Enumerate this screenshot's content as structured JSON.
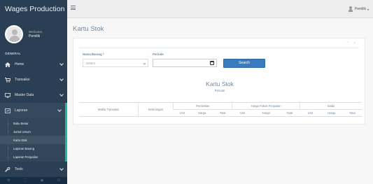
{
  "app": {
    "title": "Wages Production"
  },
  "profile": {
    "welcome": "Welcome,",
    "name": "Pemilik"
  },
  "sidebar": {
    "section": "GENERAL",
    "items": [
      {
        "label": "Home",
        "icon": "home-icon"
      },
      {
        "label": "Transaksi",
        "icon": "cart-icon"
      },
      {
        "label": "Master Data",
        "icon": "desktop-icon"
      },
      {
        "label": "Laporan",
        "icon": "report-icon"
      }
    ],
    "laporan_sub": [
      "Buku Besar",
      "Jurnal Umum",
      "Kartu Stok",
      "Laporan Barang",
      "Laporan Penjualan"
    ],
    "tools": {
      "label": "Tools",
      "icon": "wrench-icon"
    }
  },
  "topnav": {
    "user": "Pemilik"
  },
  "page": {
    "title": "Kartu Stok"
  },
  "panel_tools": "^ ×",
  "form": {
    "barang_label": "Nama Barang *",
    "barang_value": "Select",
    "periode_label": "Periode",
    "periode_value": "",
    "search_label": "Search"
  },
  "report": {
    "title": "Kartu Stok",
    "subtitle": "Periode",
    "groups": [
      "Pembelian",
      "Harga Pokok Penjualan",
      "Saldo"
    ],
    "col_waktu": "Waktu Transaksi",
    "col_keterangan": "Keterangan",
    "sub_cols": [
      "Unit",
      "Harga",
      "Total"
    ]
  },
  "colors": {
    "sidebar": "#2A3F54",
    "accent": "#1ABB9C",
    "button": "#3A7BBF"
  }
}
